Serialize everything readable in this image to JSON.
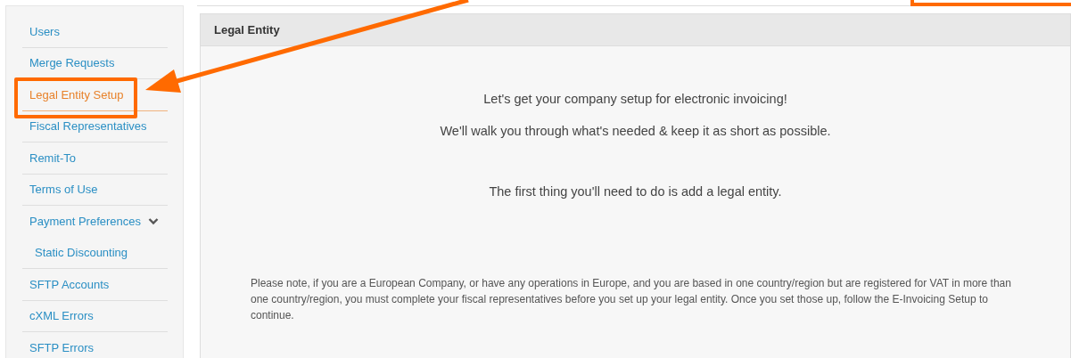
{
  "sidebar": {
    "items": [
      {
        "label": "Users",
        "selected": false,
        "highlighted": false
      },
      {
        "label": "Merge Requests",
        "selected": false,
        "highlighted": false
      },
      {
        "label": "Legal Entity Setup",
        "selected": true,
        "highlighted": true
      },
      {
        "label": "Fiscal Representatives",
        "selected": false,
        "highlighted": false
      },
      {
        "label": "Remit-To",
        "selected": false,
        "highlighted": false
      },
      {
        "label": "Terms of Use",
        "selected": false,
        "highlighted": false
      },
      {
        "label": "Payment Preferences",
        "selected": false,
        "highlighted": false,
        "expanded": true,
        "children": [
          {
            "label": "Static Discounting",
            "selected": false,
            "highlighted": false
          }
        ]
      },
      {
        "label": "SFTP Accounts",
        "selected": false,
        "highlighted": false
      },
      {
        "label": "cXML Errors",
        "selected": false,
        "highlighted": false
      },
      {
        "label": "SFTP Errors",
        "selected": false,
        "highlighted": false
      }
    ]
  },
  "panel": {
    "title": "Legal Entity",
    "intro": [
      "Let's get your company setup for electronic invoicing!",
      "We'll walk you through what's needed & keep it as short as possible."
    ],
    "first_step": "The first thing you'll need to do is add a legal entity.",
    "note": "Please note, if you are a European Company, or have any operations in Europe, and you are based in one country/region but are registered for VAT in more than one country/region, you must complete your fiscal representatives before you set up your legal entity. Once you set those up, follow the E-Invoicing Setup to continue."
  },
  "callout_arrow": true,
  "corner_frame": true
}
